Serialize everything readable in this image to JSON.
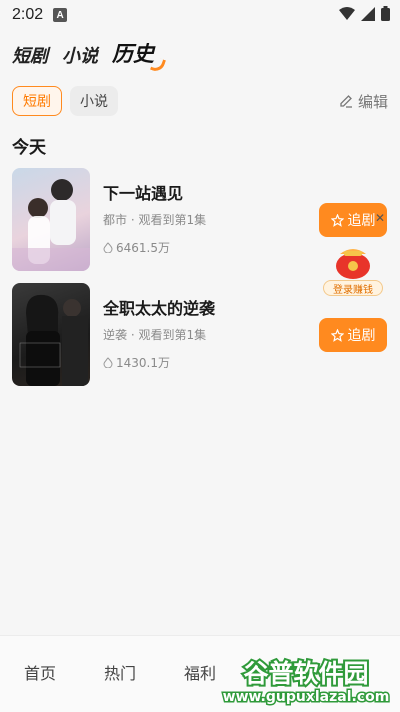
{
  "status_bar": {
    "time": "2:02",
    "badge": "A"
  },
  "top_tabs": [
    "短剧",
    "小说",
    "历史"
  ],
  "filters": {
    "items": [
      "短剧",
      "小说"
    ],
    "edit_label": "编辑"
  },
  "section": {
    "title": "今天"
  },
  "dramas": [
    {
      "title": "下一站遇见",
      "subtitle": "都市 · 观看到第1集",
      "views": "6461.5万",
      "follow_label": "追剧"
    },
    {
      "title": "全职太太的逆袭",
      "subtitle": "逆袭 · 观看到第1集",
      "views": "1430.1万",
      "follow_label": "追剧"
    }
  ],
  "floating": {
    "gift_label": "登录赚钱"
  },
  "bottom_nav": [
    "首页",
    "热门",
    "福利"
  ],
  "watermark": {
    "line1": "谷普软件园",
    "line2": "www.gupuxlazal.com"
  },
  "colors": {
    "accent": "#ff8a1f",
    "background": "#f6f6f6"
  }
}
